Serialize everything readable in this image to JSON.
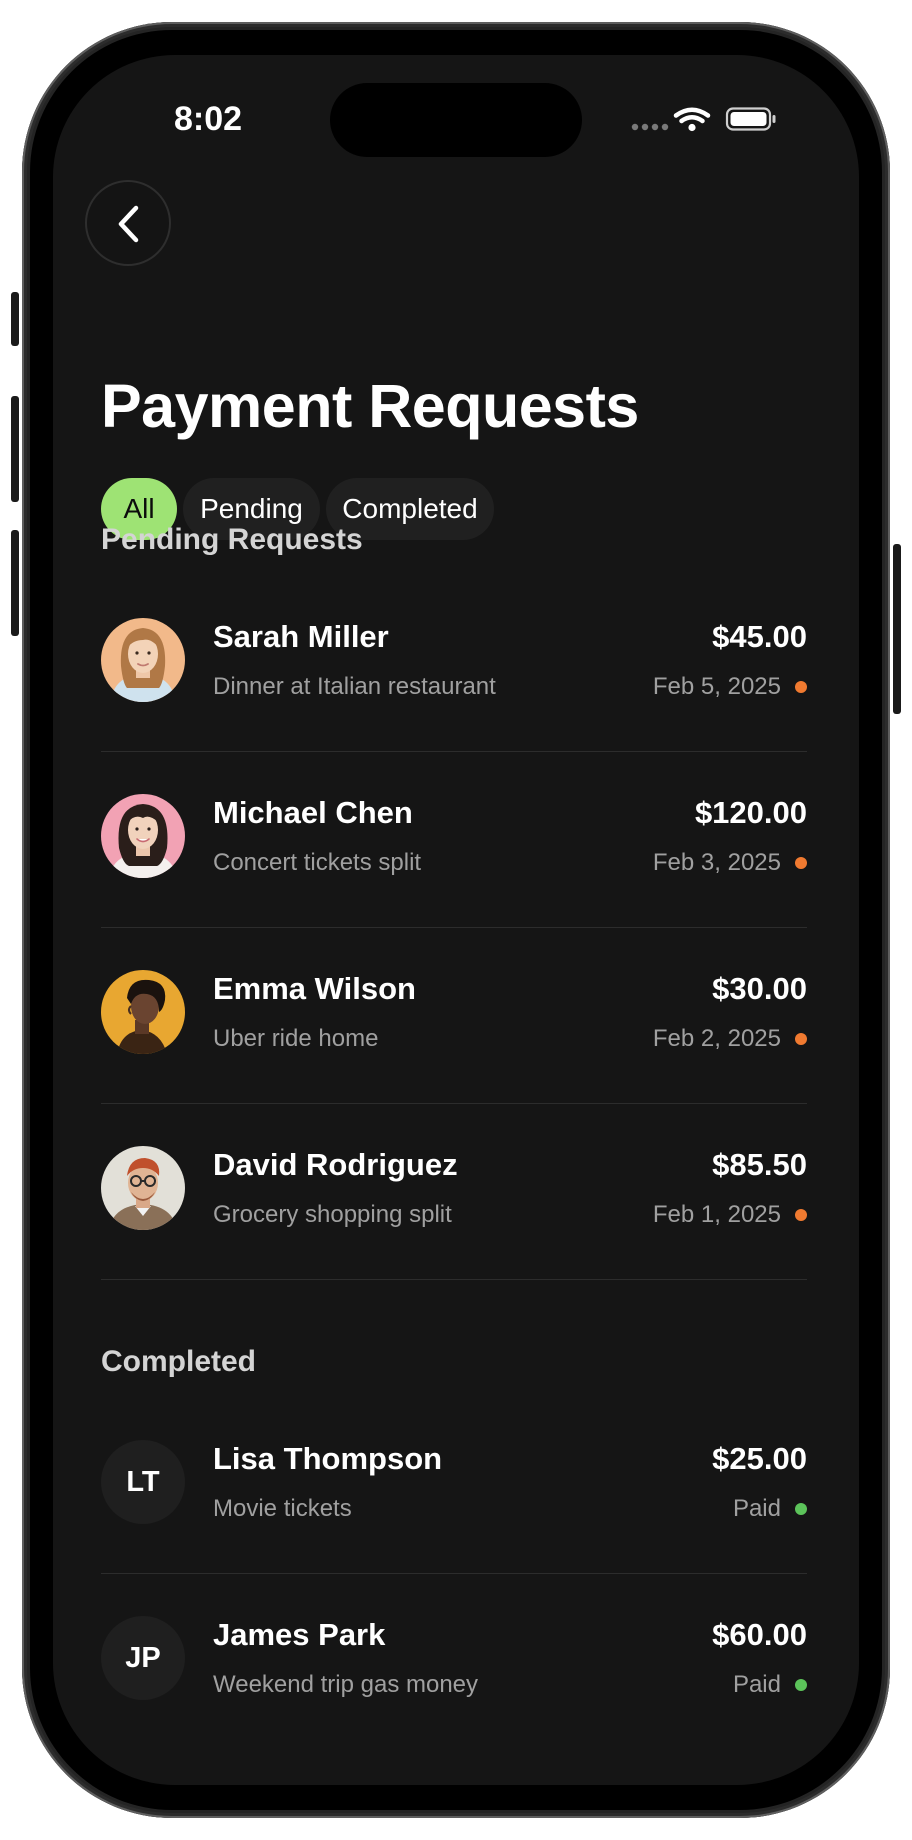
{
  "status_bar": {
    "time": "8:02"
  },
  "page": {
    "title": "Payment Requests"
  },
  "filters": [
    {
      "label": "All",
      "active": true
    },
    {
      "label": "Pending",
      "active": false
    },
    {
      "label": "Completed",
      "active": false
    }
  ],
  "sections": {
    "pending_title": "Pending Requests",
    "completed_title": "Completed"
  },
  "colors": {
    "accent": "#9ee374",
    "pending": "#f07a30",
    "paid": "#5cc35a"
  },
  "pending": [
    {
      "name": "Sarah Miller",
      "note": "Dinner at Italian restaurant",
      "amount": "$45.00",
      "date": "Feb 5, 2025",
      "status": "pending",
      "avatar": "photo"
    },
    {
      "name": "Michael Chen",
      "note": "Concert tickets split",
      "amount": "$120.00",
      "date": "Feb 3, 2025",
      "status": "pending",
      "avatar": "photo"
    },
    {
      "name": "Emma Wilson",
      "note": "Uber ride home",
      "amount": "$30.00",
      "date": "Feb 2, 2025",
      "status": "pending",
      "avatar": "photo"
    },
    {
      "name": "David Rodriguez",
      "note": "Grocery shopping split",
      "amount": "$85.50",
      "date": "Feb 1, 2025",
      "status": "pending",
      "avatar": "photo"
    }
  ],
  "completed": [
    {
      "name": "Lisa Thompson",
      "initials": "LT",
      "note": "Movie tickets",
      "amount": "$25.00",
      "date": "Paid",
      "status": "paid"
    },
    {
      "name": "James Park",
      "initials": "JP",
      "note": "Weekend trip gas money",
      "amount": "$60.00",
      "date": "Paid",
      "status": "paid"
    }
  ]
}
